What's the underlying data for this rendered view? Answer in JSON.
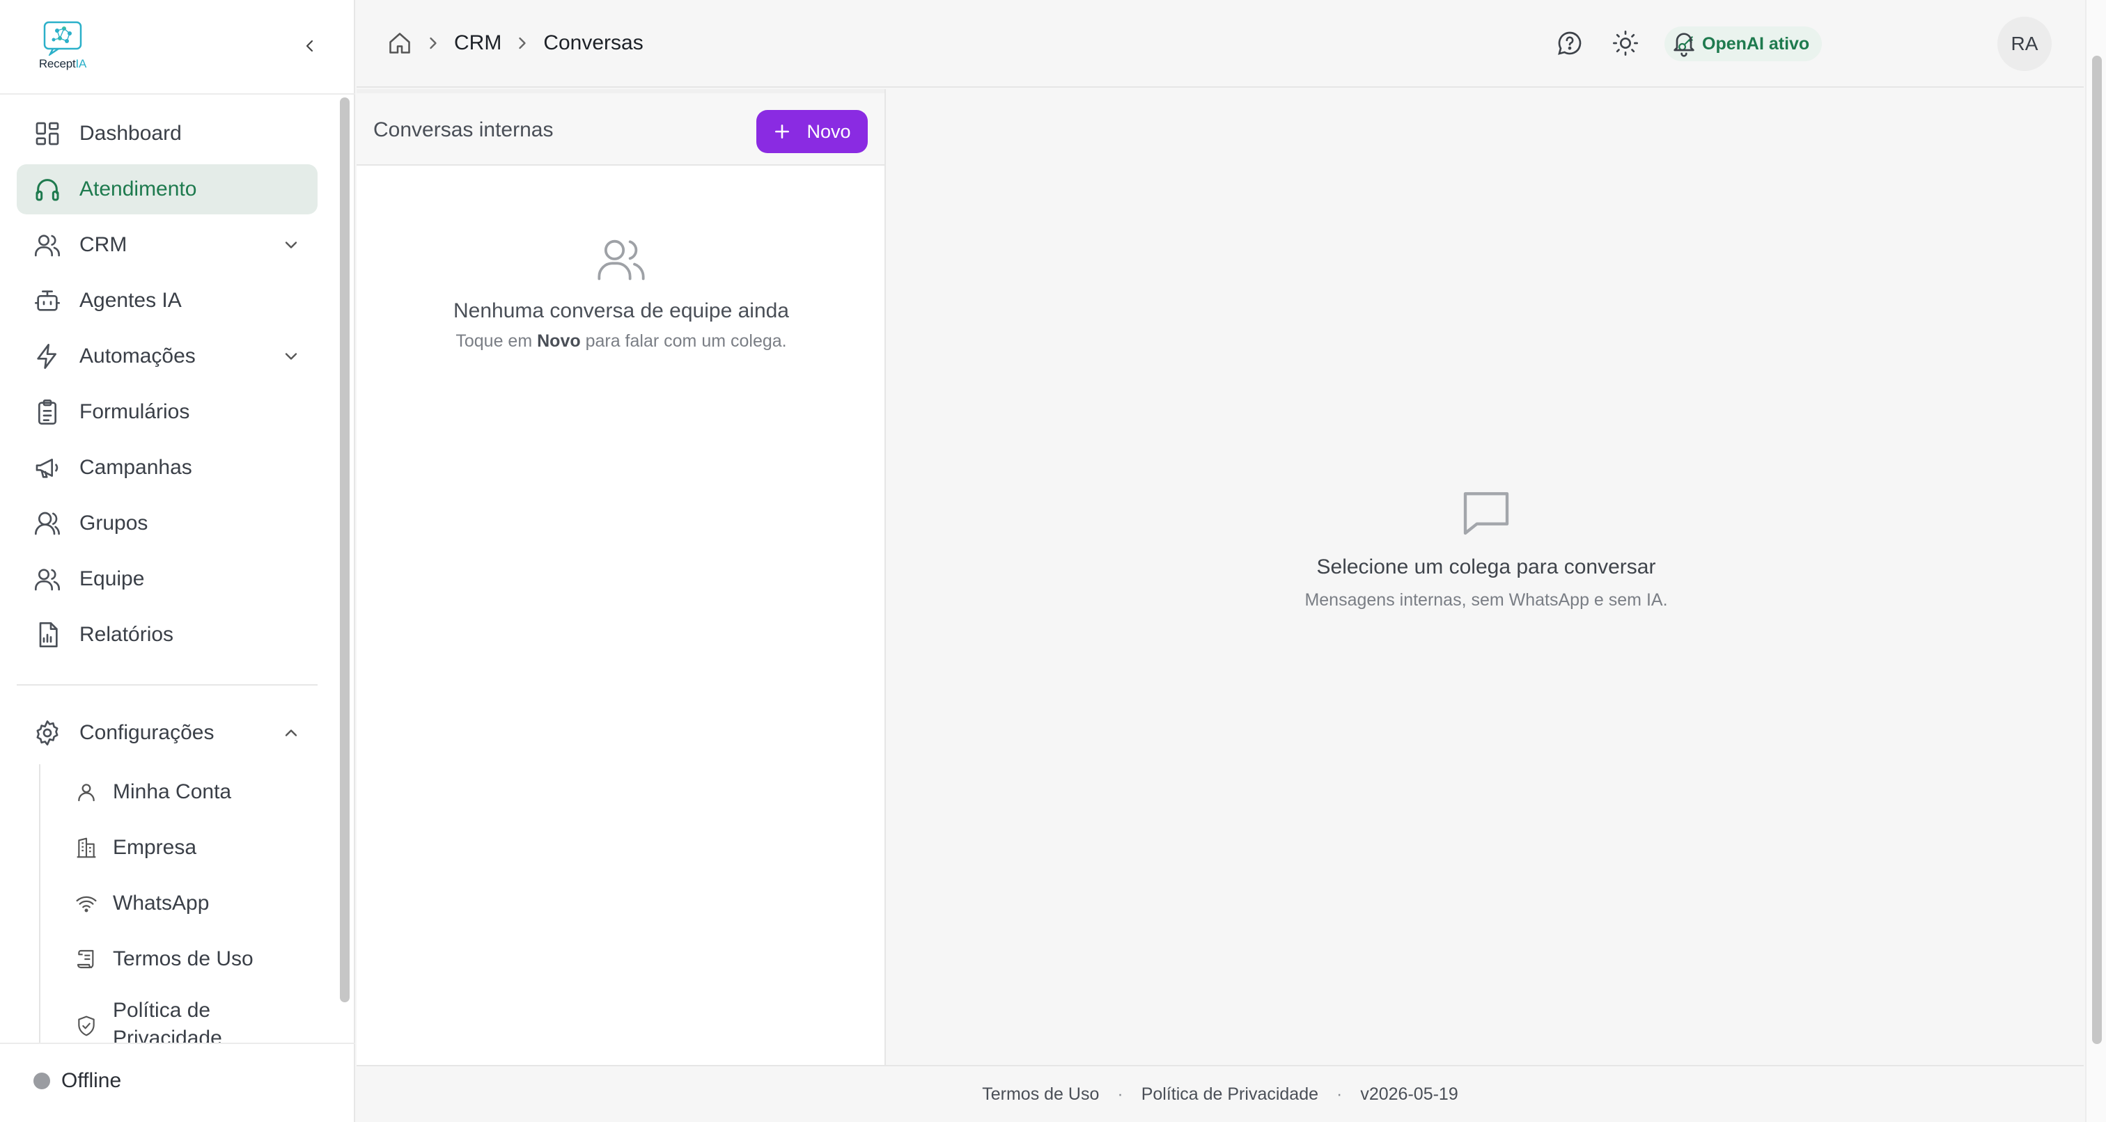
{
  "brand": {
    "name_main": "Recept",
    "name_accent": "IA"
  },
  "sidebar": {
    "items": [
      {
        "label": "Dashboard",
        "icon": "dashboard-icon"
      },
      {
        "label": "Atendimento",
        "icon": "headset-icon",
        "active": true
      },
      {
        "label": "CRM",
        "icon": "users-icon",
        "expandable": true
      },
      {
        "label": "Agentes IA",
        "icon": "bot-icon"
      },
      {
        "label": "Automações",
        "icon": "zap-icon",
        "expandable": true
      },
      {
        "label": "Formulários",
        "icon": "clipboard-icon"
      },
      {
        "label": "Campanhas",
        "icon": "megaphone-icon"
      },
      {
        "label": "Grupos",
        "icon": "group-icon"
      },
      {
        "label": "Equipe",
        "icon": "team-icon"
      },
      {
        "label": "Relatórios",
        "icon": "report-icon"
      }
    ],
    "settings": {
      "label": "Configurações",
      "icon": "gear-icon",
      "expanded": true,
      "children": [
        {
          "label": "Minha Conta",
          "icon": "user-icon"
        },
        {
          "label": "Empresa",
          "icon": "building-icon"
        },
        {
          "label": "WhatsApp",
          "icon": "wifi-icon"
        },
        {
          "label": "Termos de Uso",
          "icon": "scroll-icon"
        },
        {
          "label": "Política de Privacidade",
          "icon": "shield-check-icon"
        }
      ]
    },
    "status": {
      "label": "Offline",
      "color": "#9a9ca1"
    }
  },
  "header": {
    "breadcrumb": [
      "CRM",
      "Conversas"
    ],
    "openai_badge": "OpenAI ativo",
    "avatar_initials": "RA"
  },
  "list_panel": {
    "title": "Conversas internas",
    "new_button": "Novo",
    "empty_title": "Nenhuma conversa de equipe ainda",
    "empty_hint_before": "Toque em",
    "empty_hint_bold": "Novo",
    "empty_hint_after": "para falar com um colega."
  },
  "detail_panel": {
    "empty_title": "Selecione um colega para conversar",
    "empty_subtitle": "Mensagens internas, sem WhatsApp e sem IA."
  },
  "footer": {
    "terms": "Termos de Uso",
    "privacy": "Política de Privacidade",
    "version": "v2026-05-19",
    "separator": "·"
  },
  "colors": {
    "accent_green": "#1e7a4e",
    "active_bg": "#e4ece8",
    "primary_purple": "#8a2be2"
  }
}
